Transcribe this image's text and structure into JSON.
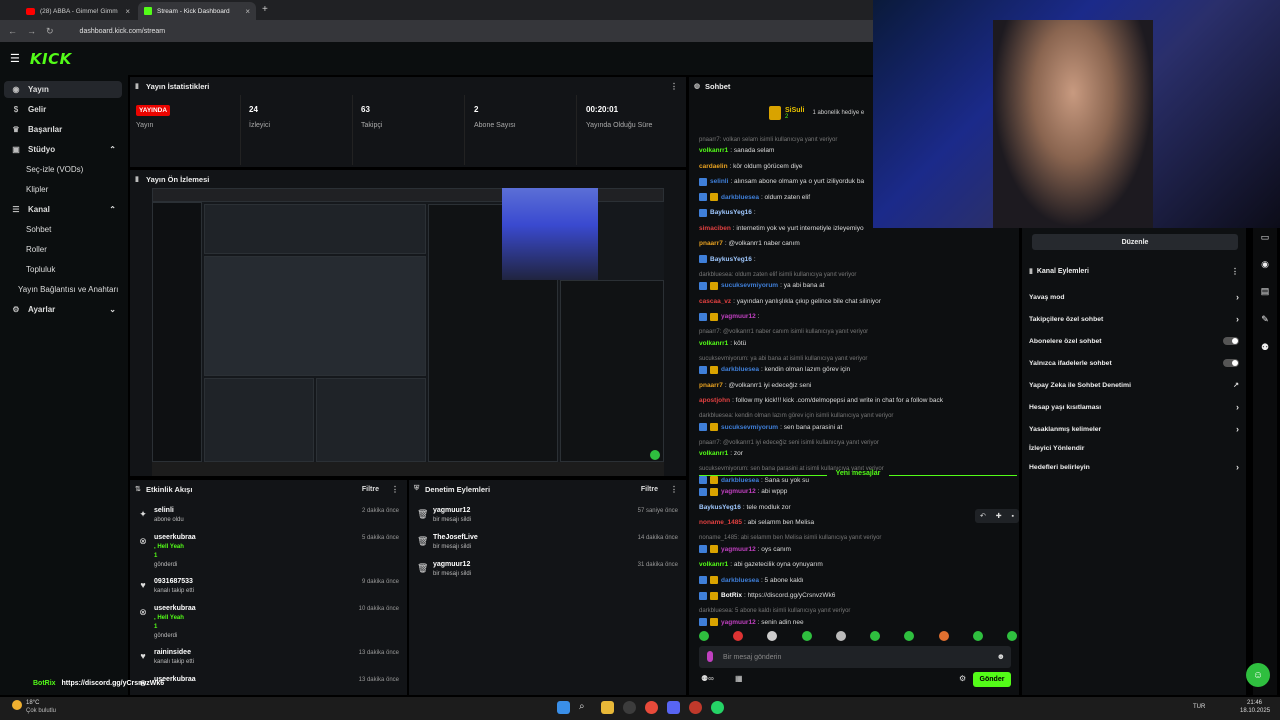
{
  "browser": {
    "tabs": [
      {
        "title": "(28) ABBA - Gimme! Gimm"
      },
      {
        "title": "Stream - Kick Dashboard"
      }
    ],
    "url": "dashboard.kick.com/stream"
  },
  "brand": {
    "logo": "KICK",
    "accent": "#53fc18"
  },
  "sidebar": {
    "items": [
      {
        "label": "Yayın",
        "icon": "broadcast-icon"
      },
      {
        "label": "Gelir",
        "icon": "coin-icon"
      },
      {
        "label": "Başarılar",
        "icon": "trophy-icon"
      },
      {
        "label": "Stüdyo",
        "icon": "studio-icon"
      },
      {
        "label": "Seç-izle (VODs)"
      },
      {
        "label": "Klipler"
      },
      {
        "label": "Kanal",
        "icon": "channel-icon"
      },
      {
        "label": "Sohbet"
      },
      {
        "label": "Roller"
      },
      {
        "label": "Topluluk"
      },
      {
        "label": "Yayın Bağlantısı ve Anahtarı"
      },
      {
        "label": "Ayarlar",
        "icon": "gear-icon"
      }
    ]
  },
  "stats": {
    "title": "Yayın İstatistikleri",
    "live_badge": "YAYINDA",
    "live_label": "Yayın",
    "cells": [
      {
        "value": "24",
        "label": "İzleyici"
      },
      {
        "value": "63",
        "label": "Takipçi"
      },
      {
        "value": "2",
        "label": "Abone Sayısı"
      },
      {
        "value": "00:20:01",
        "label": "Yayında Olduğu Süre"
      }
    ]
  },
  "preview": {
    "title": "Yayın Ön İzlemesi"
  },
  "activity": {
    "title": "Etkinlik Akışı",
    "filter": "Filtre",
    "items": [
      {
        "name": "selinli",
        "sub": "abone oldu",
        "time": "2 dakika önce"
      },
      {
        "name": "useerkubraa",
        "gift": ", Hell Yeah",
        "count": "1",
        "sub": "gönderdi",
        "time": "5 dakika önce"
      },
      {
        "name": "0931687533",
        "sub": "kanalı takip etti",
        "time": "9 dakika önce"
      },
      {
        "name": "useerkubraa",
        "gift": ", Hell Yeah",
        "count": "1",
        "sub": "gönderdi",
        "time": "10 dakika önce"
      },
      {
        "name": "raininsidee",
        "sub": "kanalı takip etti",
        "time": "13 dakika önce"
      },
      {
        "name": "useerkubraa",
        "sub": "",
        "time": "13 dakika önce"
      }
    ]
  },
  "moderation": {
    "title": "Denetim Eylemleri",
    "filter": "Filtre",
    "items": [
      {
        "name": "yagmuur12",
        "sub": "bir mesajı sildi",
        "time": "57 saniye önce"
      },
      {
        "name": "TheJosefLive",
        "sub": "bir mesajı sildi",
        "time": "14 dakika önce"
      },
      {
        "name": "yagmuur12",
        "sub": "bir mesajı sildi",
        "time": "31 dakika önce"
      }
    ]
  },
  "chat": {
    "title": "Sohbet",
    "pinned_user": "SiSuli",
    "pinned_num": "2",
    "pinned_text": "1 abonelik hediye e",
    "new_messages": "Yeni mesajlar",
    "input_placeholder": "Bir mesaj gönderin",
    "send": "Gönder",
    "lines": [
      {
        "type": "reply",
        "text": "pnaarr7: volkan selam isimli kullanıcıya yanıt veriyor"
      },
      {
        "user": "volkanrr1",
        "color": "#53fc18",
        "text": ": sanada selam"
      },
      {
        "user": "cardaelin",
        "color": "#e6a020",
        "text": ": kör oldum görücem diye"
      },
      {
        "user": "selinli",
        "color": "#3f7fd9",
        "text": ": alınsam abone olmam ya o yurt iziliyorduk ba",
        "badges": 1
      },
      {
        "user": "darkbluesea",
        "color": "#3f7fd9",
        "text": ": oldum zaten elif",
        "badges": 2
      },
      {
        "user": "BaykusYeg16",
        "color": "#9fc8ff",
        "text": ":",
        "badges": 1
      },
      {
        "user": "simaciben",
        "color": "#e04040",
        "text": ": internetim yok ve yurt internetiyle izleyemiyo"
      },
      {
        "user": "pnaarr7",
        "color": "#e6a020",
        "text": ": @volkanrr1 naber canım"
      },
      {
        "user": "BaykusYeg16",
        "color": "#9fc8ff",
        "text": ":",
        "badges": 1
      },
      {
        "type": "reply",
        "text": "darkbluesea: oldum zaten elif isimli kullanıcıya yanıt veriyor"
      },
      {
        "user": "sucuksevmiyorum",
        "color": "#3f7fd9",
        "text": ": ya abi bana at",
        "badges": 2
      },
      {
        "user": "cascaa_vz",
        "color": "#e04040",
        "text": ": yayından yanlışlıkla çıkıp gelince bile chat siliniyor"
      },
      {
        "user": "yagmuur12",
        "color": "#c040c0",
        "text": ":",
        "badges": 2
      },
      {
        "type": "reply",
        "text": "pnaarr7: @volkanrr1 naber canım isimli kullanıcıya yanıt veriyor"
      },
      {
        "user": "volkanrr1",
        "color": "#53fc18",
        "text": ": kötü"
      },
      {
        "type": "reply",
        "text": "sucuksevmiyorum: ya abi bana at isimli kullanıcıya yanıt veriyor"
      },
      {
        "user": "darkbluesea",
        "color": "#3f7fd9",
        "text": ": kendin olman lazım görev için",
        "badges": 2
      },
      {
        "user": "pnaarr7",
        "color": "#e6a020",
        "text": ": @volkanrr1 iyi edeceğiz seni"
      },
      {
        "user": "apostjohn",
        "color": "#e04040",
        "text": ": follow my kick!!! kick .com/delmopepsi and write in chat for a follow back"
      },
      {
        "type": "reply",
        "text": "darkbluesea: kendin olman lazım görev için isimli kullanıcıya yanıt veriyor"
      },
      {
        "user": "sucuksevmiyorum",
        "color": "#3f7fd9",
        "text": ": sen bana parasini at",
        "badges": 2
      },
      {
        "type": "reply",
        "text": "pnaarr7: @volkanrr1 iyi edeceğiz seni isimli kullanıcıya yanıt veriyor"
      },
      {
        "user": "volkanrr1",
        "color": "#53fc18",
        "text": ": zor"
      },
      {
        "type": "reply",
        "text": "sucuksevmiyorum: sen bana parasini at isimli kullanıcıya yanıt veriyor"
      },
      {
        "user": "darkbluesea",
        "color": "#3f7fd9",
        "text": ": Sana su yok su",
        "badges": 2
      }
    ],
    "new_lines": [
      {
        "user": "yagmuur12",
        "color": "#c040c0",
        "text": ": abi wppp",
        "badges": 2
      },
      {
        "user": "BaykusYeg16",
        "color": "#9fc8ff",
        "text": ": tele modluk zor"
      },
      {
        "user": "noname_1485",
        "color": "#e04040",
        "text": ": abi selamm ben Melisa"
      },
      {
        "type": "reply",
        "text": "noname_1485: abi selamm ben Melisa isimli kullanıcıya yanıt veriyor"
      },
      {
        "user": "yagmuur12",
        "color": "#c040c0",
        "text": ": oys canım",
        "badges": 2
      },
      {
        "user": "volkanrr1",
        "color": "#53fc18",
        "text": ": abi gazetecilik oyna oynuyarım"
      },
      {
        "user": "darkbluesea",
        "color": "#3f7fd9",
        "text": ": 5 abone kaldı",
        "badges": 2
      },
      {
        "user": "BotRix",
        "color": "#fff",
        "text": ": https://discord.gg/yCrsnvzWk6",
        "badges": 2
      },
      {
        "type": "reply",
        "text": "darkbluesea: 5 abone kaldı isimli kullanıcıya yanıt veriyor"
      },
      {
        "user": "yagmuur12",
        "color": "#c040c0",
        "text": ": senin adin nee",
        "badges": 2
      }
    ]
  },
  "channel_actions": {
    "edit": "Düzenle",
    "title": "Kanal Eylemleri",
    "items": [
      {
        "label": "Yavaş mod",
        "ctrl": "arrow"
      },
      {
        "label": "Takipçilere özel sohbet",
        "ctrl": "arrow"
      },
      {
        "label": "Abonelere özel sohbet",
        "ctrl": "toggle"
      },
      {
        "label": "Yalnızca ifadelerle sohbet",
        "ctrl": "toggle"
      },
      {
        "label": "Yapay Zeka ile Sohbet Denetimi",
        "ctrl": "ext"
      },
      {
        "label": "Hesap yaşı kısıtlaması",
        "ctrl": "arrow"
      },
      {
        "label": "Yasaklanmış kelimeler",
        "ctrl": "arrow"
      },
      {
        "label": "İzleyici Yönlendir",
        "ctrl": "none"
      },
      {
        "label": "Hedefleri belirleyin",
        "ctrl": "arrow"
      }
    ]
  },
  "overlay": {
    "botrix": "BotRix",
    "botrix_link": "https://discord.gg/yCrsnvzWk6"
  },
  "taskbar": {
    "weather_temp": "18°C",
    "weather_desc": "Çok bulutlu",
    "lang": "TUR",
    "time": "21:46",
    "date": "18.10.2025"
  }
}
